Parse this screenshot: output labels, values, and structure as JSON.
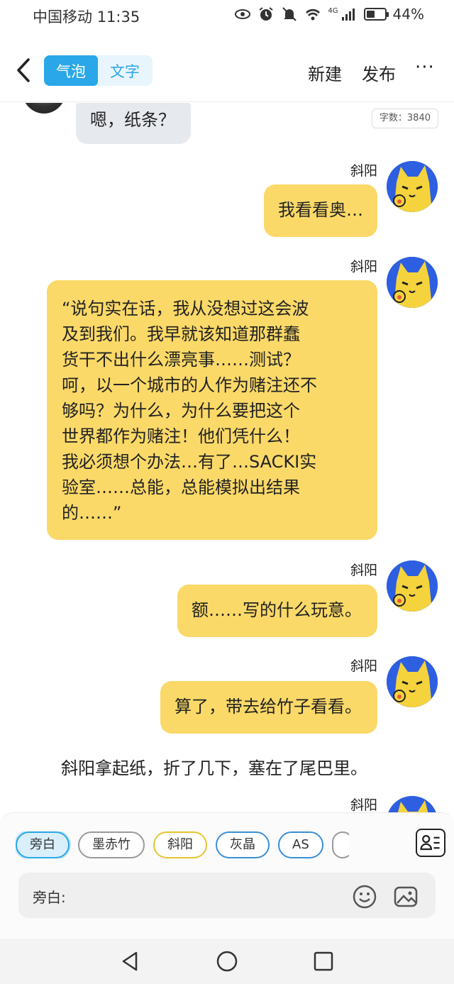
{
  "status_bar": {
    "carrier": "中国移动",
    "time": "11:35",
    "network": "4G",
    "battery_text": "44%",
    "battery_level": 0.44
  },
  "header": {
    "tabs": [
      {
        "label": "气泡",
        "active": true
      },
      {
        "label": "文字",
        "active": false
      }
    ],
    "new_label": "新建",
    "publish_label": "发布",
    "more_label": "···",
    "accent": "#2aa7e8"
  },
  "chat": {
    "word_count": "字数：3840",
    "messages": [
      {
        "side": "left",
        "text": "嗯，纸条？",
        "color": "#e6e9ee"
      },
      {
        "side": "right",
        "name": "斜阳",
        "text": "我看看奥…",
        "color": "#fbd968"
      },
      {
        "side": "right",
        "name": "斜阳",
        "lines": [
          "“说句实在话，我从没想过这会波",
          "及到我们。我早就该知道那群蠢",
          "货干不出什么漂亮事……测试？",
          "呵，以一个城市的人作为赌注还不",
          "够吗？为什么，为什么要把这个",
          "世界都作为赌注！他们凭什么！",
          "我必须想个办法…有了…SACKI实",
          "验室……总能，总能模拟出结果",
          "的……”"
        ],
        "color": "#fbd968"
      },
      {
        "side": "right",
        "name": "斜阳",
        "text": "额……写的什么玩意。",
        "color": "#fbd968"
      },
      {
        "side": "right",
        "name": "斜阳",
        "text": "算了，带去给竹子看看。",
        "color": "#fbd968"
      }
    ],
    "narration": "斜阳拿起纸，折了几下，塞在了尾巴里。",
    "last_name": "斜阳"
  },
  "panel": {
    "chips": [
      "旁白",
      "墨赤竹",
      "斜阳",
      "灰晶",
      "AS"
    ],
    "input_label": "旁白:"
  }
}
